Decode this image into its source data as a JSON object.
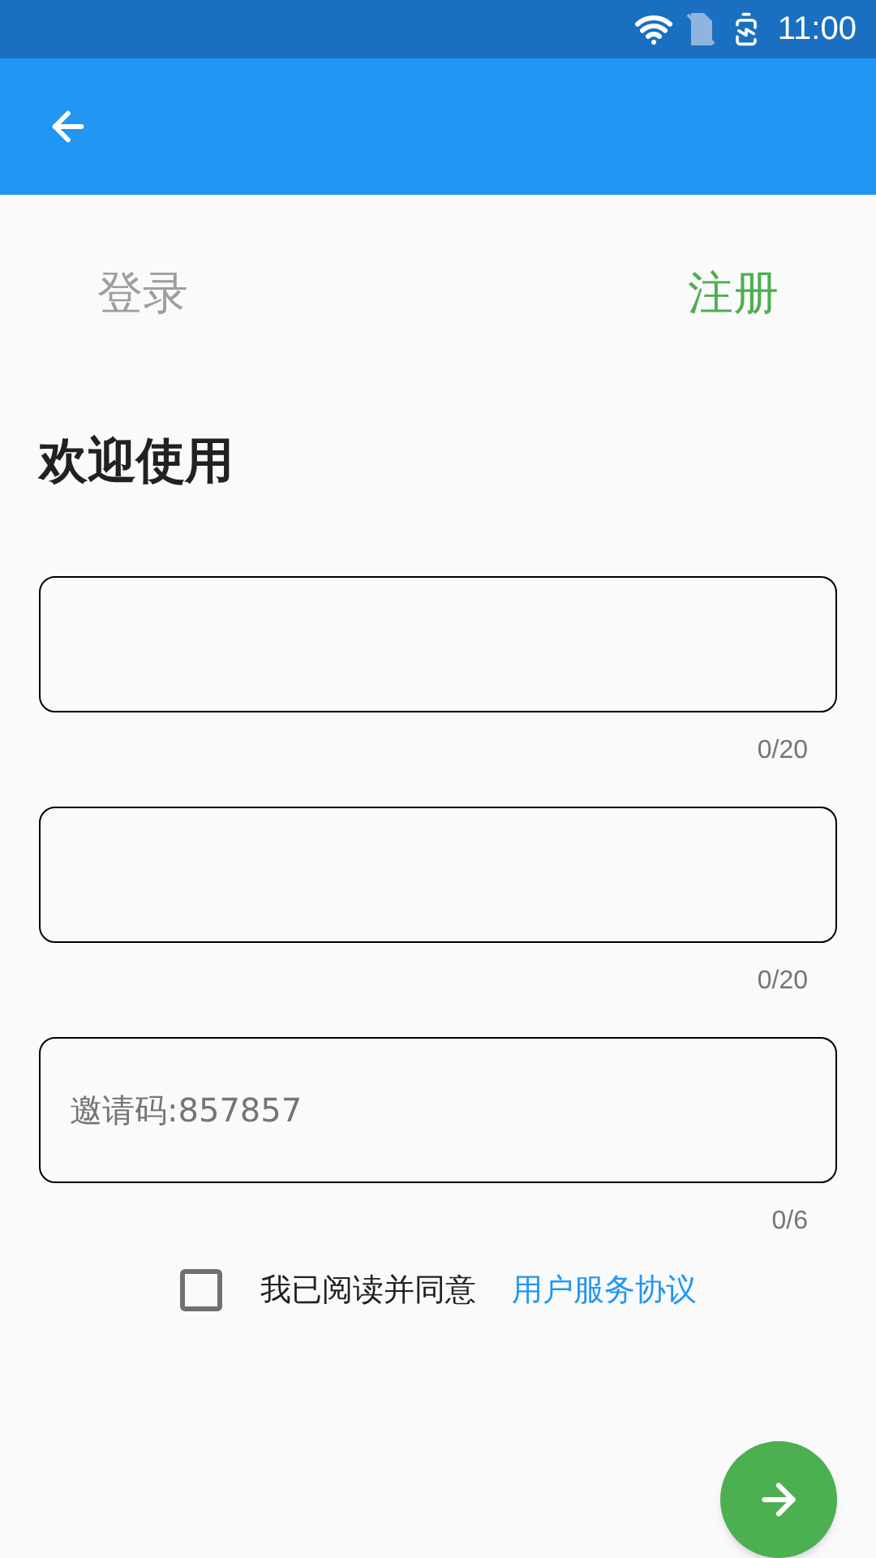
{
  "status_bar": {
    "time": "11:00"
  },
  "tabs": [
    {
      "label": "登录",
      "selected": false
    },
    {
      "label": "注册",
      "selected": true
    }
  ],
  "title": "欢迎使用",
  "fields": [
    {
      "counter": "0/20"
    },
    {
      "counter": "0/20"
    },
    {
      "placeholder": "邀请码:857857",
      "counter": "0/6"
    }
  ],
  "agreement": {
    "checked": false,
    "text": "我已阅读并同意",
    "link": "用户服务协议"
  }
}
